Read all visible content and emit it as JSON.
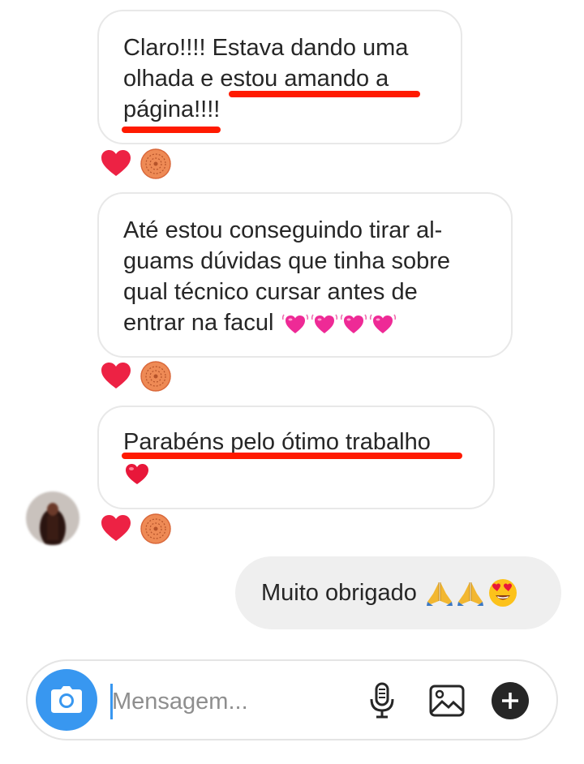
{
  "messages": [
    {
      "lines": [
        "Claro!!!! Estava dando uma",
        "olhada e estou amando a",
        "página!!!!"
      ]
    },
    {
      "lines": [
        "Até estou conseguindo tirar al-",
        "guams dúvidas que tinha sobre",
        "qual técnico cursar antes de",
        "entrar na facul"
      ]
    },
    {
      "lines": [
        "Parabéns pelo ótimo trabalho"
      ]
    }
  ],
  "reply": {
    "text": "Muito obrigado"
  },
  "composer": {
    "placeholder": "Mensagem..."
  },
  "icons": {
    "camera": "camera-icon",
    "microphone": "microphone-icon",
    "gallery": "gallery-icon",
    "add": "plus-icon",
    "heart": "heart-icon",
    "pink_heart": "vibrating-heart-emoji",
    "praying_hands": "folded-hands-emoji",
    "heart_eyes": "heart-eyes-emoji"
  },
  "colors": {
    "accent": "#3897f0",
    "underline": "#ff1a00",
    "heart": "#ed2244",
    "bubble_out": "#efefef"
  }
}
